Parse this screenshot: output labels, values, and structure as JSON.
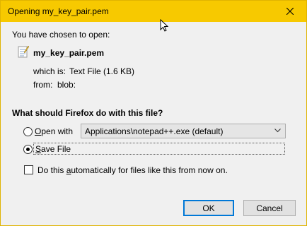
{
  "window": {
    "title": "Opening my_key_pair.pem",
    "close_glyph": "close-icon"
  },
  "dialog": {
    "intro": "You have chosen to open:",
    "file_name": "my_key_pair.pem",
    "which_is_label": "which is:",
    "which_is_value": "Text File (1.6 KB)",
    "from_label": "from:",
    "from_value": "blob:",
    "question": "What should Firefox do with this file?",
    "open_with": {
      "prefix_underlined": "O",
      "rest": "pen with",
      "selected": false
    },
    "application_select": {
      "value": "Applications\\notepad++.exe (default)"
    },
    "save_file": {
      "prefix_underlined": "S",
      "rest": "ave File",
      "selected": true
    },
    "auto_checkbox": {
      "label_prefix": "Do this ",
      "label_underlined": "a",
      "label_rest": "utomatically for files like this from now on.",
      "checked": false
    },
    "ok_label": "OK",
    "cancel_label": "Cancel"
  },
  "colors": {
    "titlebar": "#f7c900",
    "focus_border": "#0078d7"
  }
}
